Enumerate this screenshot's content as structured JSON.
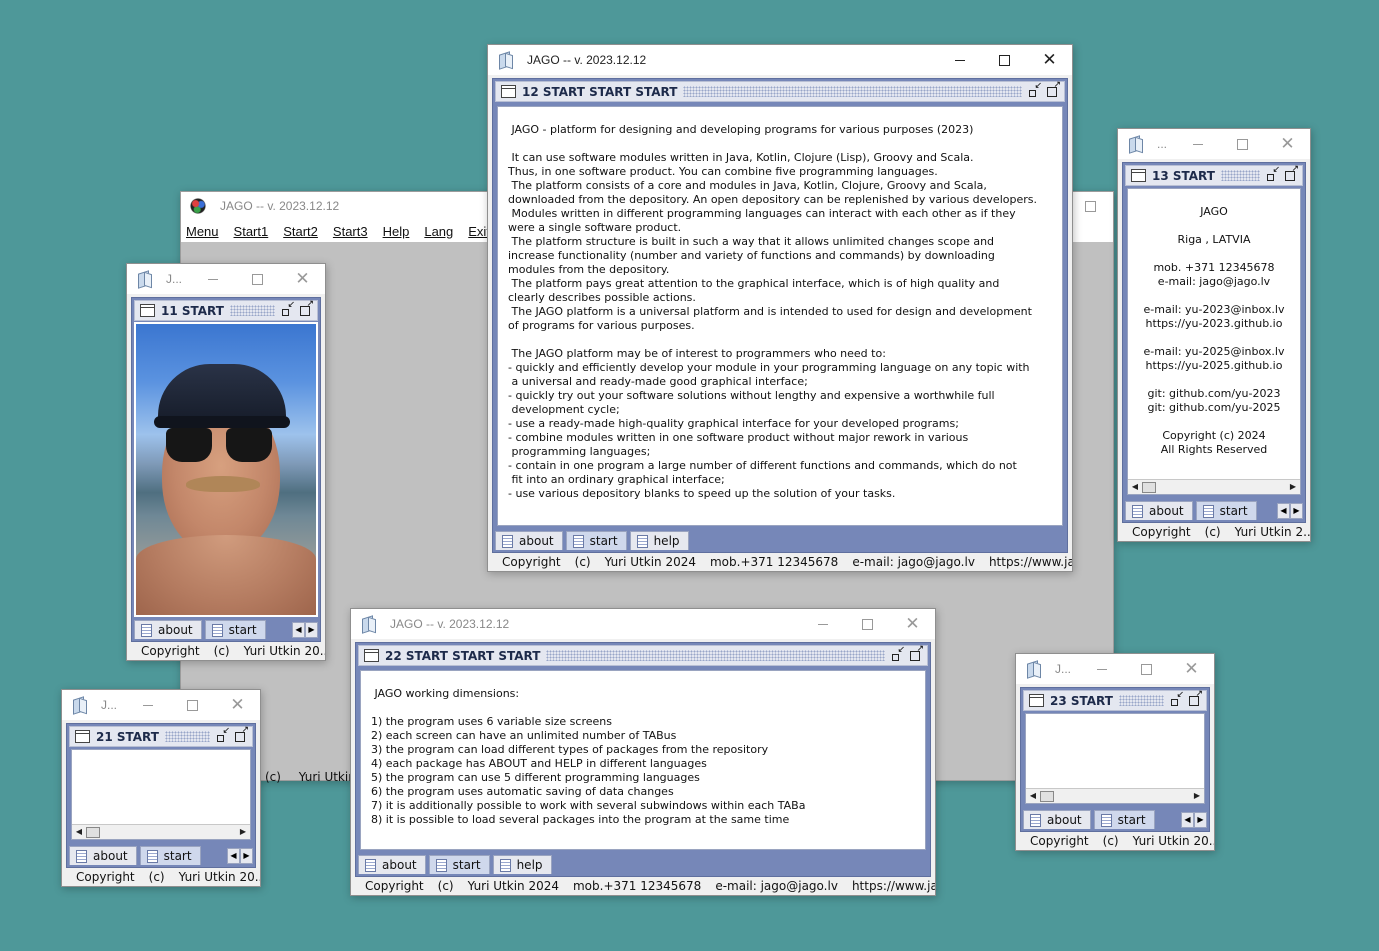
{
  "desktop": {
    "background_color": "#4e9899"
  },
  "main_window": {
    "title": "JAGO -- v. 2023.12.12",
    "menu": [
      "Menu",
      "Start1",
      "Start2",
      "Start3",
      "Help",
      "Lang",
      "Exit"
    ],
    "status_partial": [
      "(c)",
      "Yuri Utkin"
    ]
  },
  "win12": {
    "title": "JAGO -- v. 2023.12.12",
    "inner_title": "12 START START START",
    "text": " JAGO - platform for designing and developing programs for various purposes (2023)\n\n It can use software modules written in Java, Kotlin, Clojure (Lisp), Groovy and Scala.\nThus, in one software product. You can combine five programming languages.\n The platform consists of a core and modules in Java, Kotlin, Clojure, Groovy and Scala,\ndownloaded from the depository. An open depository can be replenished by various developers.\n Modules written in different programming languages can interact with each other as if they\nwere a single software product.\n The platform structure is built in such a way that it allows unlimited changes scope and\nincrease functionality (number and variety of functions and commands) by downloading\nmodules from the depository.\n The platform pays great attention to the graphical interface, which is of high quality and\nclearly describes possible actions.\n The JAGO platform is a universal platform and is intended to used for design and development\nof programs for various purposes.\n\n The JAGO platform may be of interest to programmers who need to:\n- quickly and efficiently develop your module in your programming language on any topic with\n a universal and ready-made good graphical interface;\n- quickly try out your software solutions without lengthy and expensive a worthwhile full\n development cycle;\n- use a ready-made high-quality graphical interface for your developed programs;\n- combine modules written in one software product without major rework in various\n programming languages;\n- contain in one program a large number of different functions and commands, which do not\n fit into an ordinary graphical interface;\n- use various depository blanks to speed up the solution of your tasks.",
    "tabs": [
      "about",
      "start",
      "help"
    ],
    "selected_tab": 1,
    "status": [
      "Copyright",
      "(c)",
      "Yuri Utkin 2024",
      "mob.+371 12345678",
      "e-mail: jago@jago.lv",
      "https://www.jago.lv"
    ]
  },
  "win13": {
    "title": "...",
    "inner_title": "13 START",
    "text": "JAGO\n\nRiga , LATVIA\n\nmob. +371 12345678\ne-mail: jago@jago.lv\n\ne-mail: yu-2023@inbox.lv\nhttps://yu-2023.github.io\n\ne-mail: yu-2025@inbox.lv\nhttps://yu-2025.github.io\n\ngit: github.com/yu-2023\ngit: github.com/yu-2025\n\nCopyright (c) 2024\nAll Rights Reserved",
    "tabs": [
      "about",
      "start"
    ],
    "status": [
      "Copyright",
      "(c)",
      "Yuri Utkin 2..."
    ]
  },
  "win11": {
    "title": "J...",
    "inner_title": "11 START",
    "tabs": [
      "about",
      "start"
    ],
    "status": [
      "Copyright",
      "(c)",
      "Yuri Utkin 20..."
    ]
  },
  "win22": {
    "title": "JAGO -- v. 2023.12.12",
    "inner_title": "22 START START START",
    "text": " JAGO working dimensions:\n\n1) the program uses 6 variable size screens\n2) each screen can have an unlimited number of TABus\n3) the program can load different types of packages from the repository\n4) each package has ABOUT and HELP in different languages\n5) the program can use 5 different programming languages\n6) the program uses automatic saving of data changes\n7) it is additionally possible to work with several subwindows within each TABa\n8) it is possible to load several packages into the program at the same time",
    "tabs": [
      "about",
      "start",
      "help"
    ],
    "status": [
      "Copyright",
      "(c)",
      "Yuri Utkin 2024",
      "mob.+371 12345678",
      "e-mail: jago@jago.lv",
      "https://www.jago.lv"
    ]
  },
  "win21": {
    "title": "J...",
    "inner_title": "21 START",
    "tabs": [
      "about",
      "start"
    ],
    "status": [
      "Copyright",
      "(c)",
      "Yuri Utkin 20..."
    ]
  },
  "win23": {
    "title": "J...",
    "inner_title": "23 START",
    "tabs": [
      "about",
      "start"
    ],
    "status": [
      "Copyright",
      "(c)",
      "Yuri Utkin 20..."
    ]
  }
}
